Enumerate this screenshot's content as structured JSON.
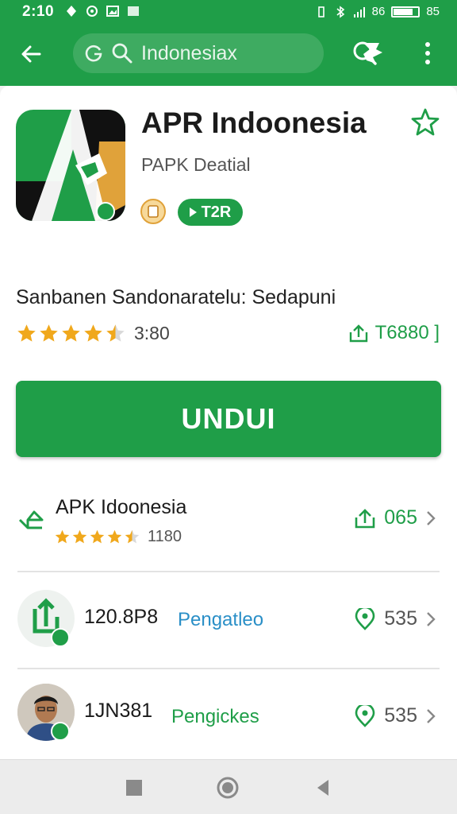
{
  "status_bar": {
    "time": "2:10",
    "right_text": "85",
    "signal_text": "86"
  },
  "toolbar": {
    "search_text": "Indonesiax",
    "icons": [
      "back-arrow-icon",
      "google-icon",
      "search-icon",
      "share-icon",
      "search-icon",
      "more-vert-icon"
    ]
  },
  "app": {
    "title": "APR Indoonesia",
    "developer": "PAPK Deatial",
    "tag": "T2R",
    "subtitle": "Sanbanen Sandonaratelu: Sedapuni",
    "rating": 4.5,
    "rating_text": "3:80",
    "downloads": "T6880 ]",
    "install_label": "UNDUI"
  },
  "list": [
    {
      "title": "APK Idoonesia",
      "rating": 4.5,
      "rating_text": "1180",
      "meta": "065"
    },
    {
      "title": "120.8P8",
      "link": "Pengatleo",
      "meta": "535"
    },
    {
      "title": "1JN381",
      "link": "Pengickes",
      "meta": "535"
    }
  ],
  "colors": {
    "brand_green": "#1f9e48",
    "star_gold": "#f0a81c",
    "link_blue": "#2a8fc7"
  }
}
